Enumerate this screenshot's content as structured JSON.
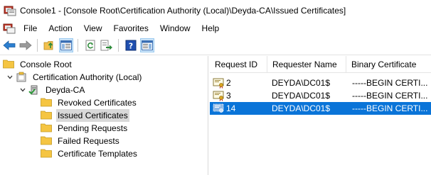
{
  "window": {
    "title": "Console1 - [Console Root\\Certification Authority (Local)\\Deyda-CA\\Issued Certificates]"
  },
  "menu": [
    "File",
    "Action",
    "View",
    "Favorites",
    "Window",
    "Help"
  ],
  "toolbar": {
    "buttons": [
      "back-icon",
      "forward-icon",
      "up-folder-icon",
      "show-hide-tree-icon",
      "refresh-icon",
      "export-list-icon",
      "help-icon",
      "show-hide-action-pane-icon"
    ]
  },
  "tree": {
    "root": "Console Root",
    "ca": "Certification Authority (Local)",
    "ca_name": "Deyda-CA",
    "folders": [
      "Revoked Certificates",
      "Issued Certificates",
      "Pending Requests",
      "Failed Requests",
      "Certificate Templates"
    ],
    "selected": "Issued Certificates"
  },
  "list": {
    "columns": [
      "Request ID",
      "Requester Name",
      "Binary Certificate"
    ],
    "rows": [
      {
        "id": "2",
        "requester": "DEYDA\\DC01$",
        "binary": "-----BEGIN CERTI..."
      },
      {
        "id": "3",
        "requester": "DEYDA\\DC01$",
        "binary": "-----BEGIN CERTI..."
      },
      {
        "id": "14",
        "requester": "DEYDA\\DC01$",
        "binary": "-----BEGIN CERTI..."
      }
    ],
    "selected_row": "14"
  },
  "colors": {
    "selection": "#0a74d8",
    "tree_selection": "#d9d9d9",
    "folder": "#f5c542"
  }
}
